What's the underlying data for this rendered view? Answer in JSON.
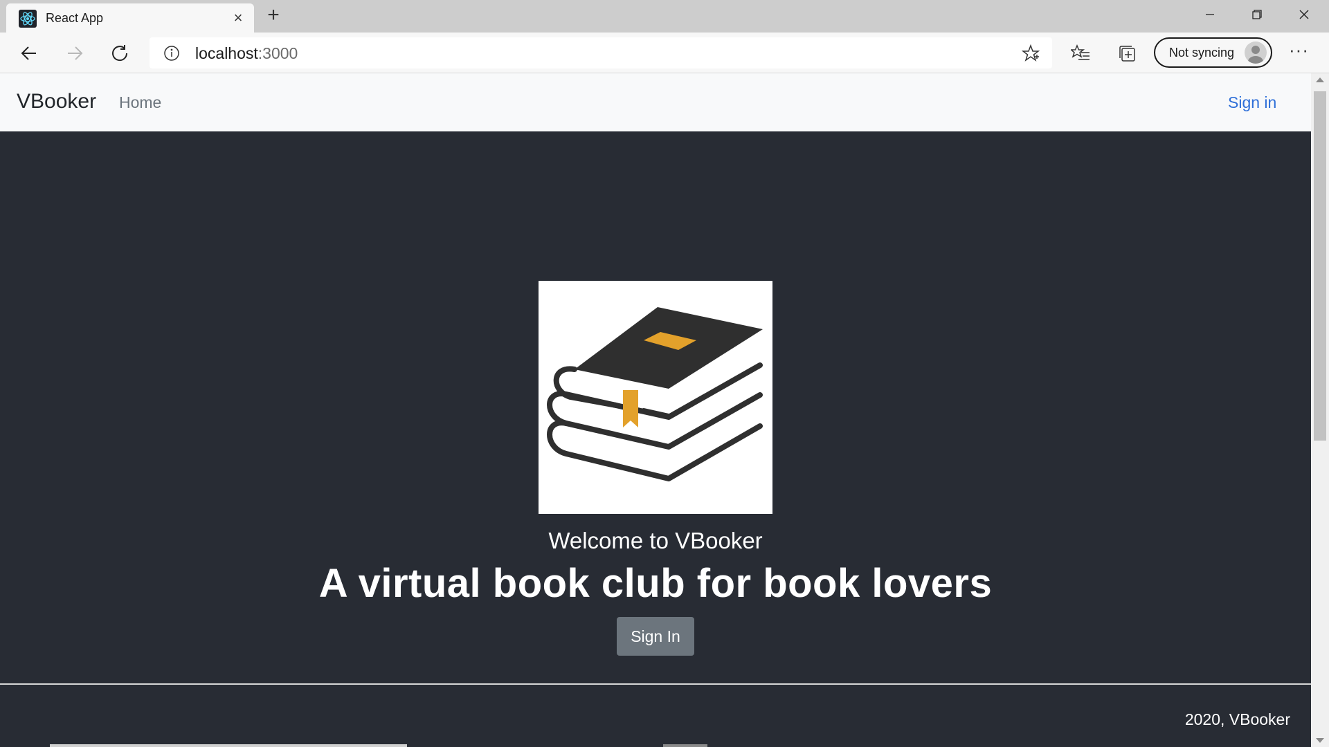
{
  "browser": {
    "tab_title": "React App",
    "tab_close_glyph": "×",
    "new_tab_glyph": "+",
    "url_host": "localhost",
    "url_port": ":3000",
    "sync_label": "Not syncing",
    "more_glyph": "···"
  },
  "navbar": {
    "brand": "VBooker",
    "home": "Home",
    "sign_in": "Sign in"
  },
  "hero": {
    "welcome": "Welcome to VBooker",
    "tagline": "A virtual book club for book lovers",
    "button": "Sign In"
  },
  "footer": {
    "text": "2020, VBooker"
  },
  "colors": {
    "page_bg": "#282c34",
    "navbar_bg": "#f8f9fa",
    "link_blue": "#2e6fd8",
    "button_gray": "#6c757d",
    "book_dark": "#2f2f2f",
    "book_accent": "#e3a12b"
  }
}
